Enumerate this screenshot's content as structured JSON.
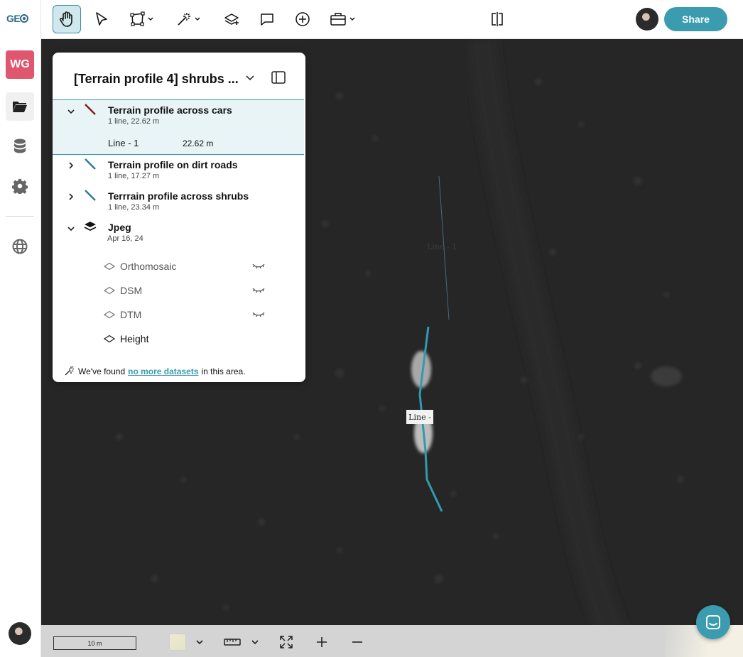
{
  "app": {
    "logo_text": "GE",
    "workspace_initials": "WG",
    "accent_color": "#3a9cae",
    "workspace_color": "#e0566f"
  },
  "rail": {
    "items": [
      {
        "name": "folder-icon",
        "active": true
      },
      {
        "name": "database-icon",
        "active": false
      },
      {
        "name": "gear-icon",
        "active": false
      },
      {
        "name": "globe-icon",
        "active": false
      }
    ]
  },
  "toolbar": {
    "tools": [
      "hand-icon",
      "pointer-icon",
      "polygon-icon",
      "magic-wand-icon",
      "add-layer-icon",
      "comment-icon",
      "add-circle-icon",
      "toolbox-icon",
      "split-view-icon"
    ],
    "selected_tool": "hand-icon",
    "share_label": "Share"
  },
  "panel": {
    "title": "[Terrain profile 4] shrubs ...",
    "groups": [
      {
        "name": "Terrain profile across cars",
        "count": "1 line,",
        "length": "22.62 m",
        "expanded": true,
        "line_color": "#7a1f1f"
      },
      {
        "name": "Terrain profile on dirt roads",
        "count": "1 line,",
        "length": "17.27 m",
        "expanded": false,
        "line_color": "#2a7a96"
      },
      {
        "name": "Terrrain profile across shrubs",
        "count": "1 line,",
        "length": "23.34 m",
        "expanded": false,
        "line_color": "#2a7a96"
      }
    ],
    "sub_item": {
      "name": "Line - 1",
      "length": "22.62 m"
    },
    "dataset": {
      "name": "Jpeg",
      "date": "Apr 16, 24",
      "layers": [
        {
          "name": "Orthomosaic",
          "hidden": true
        },
        {
          "name": "DSM",
          "hidden": true
        },
        {
          "name": "DTM",
          "hidden": true
        },
        {
          "name": "Height",
          "hidden": false
        }
      ]
    },
    "footer": {
      "prefix": "We've found",
      "link": "no more datasets",
      "suffix": "in this area."
    }
  },
  "map": {
    "faint_label": "Line - 1",
    "line_label": "Line -"
  },
  "bottom": {
    "scale": "10 m"
  }
}
